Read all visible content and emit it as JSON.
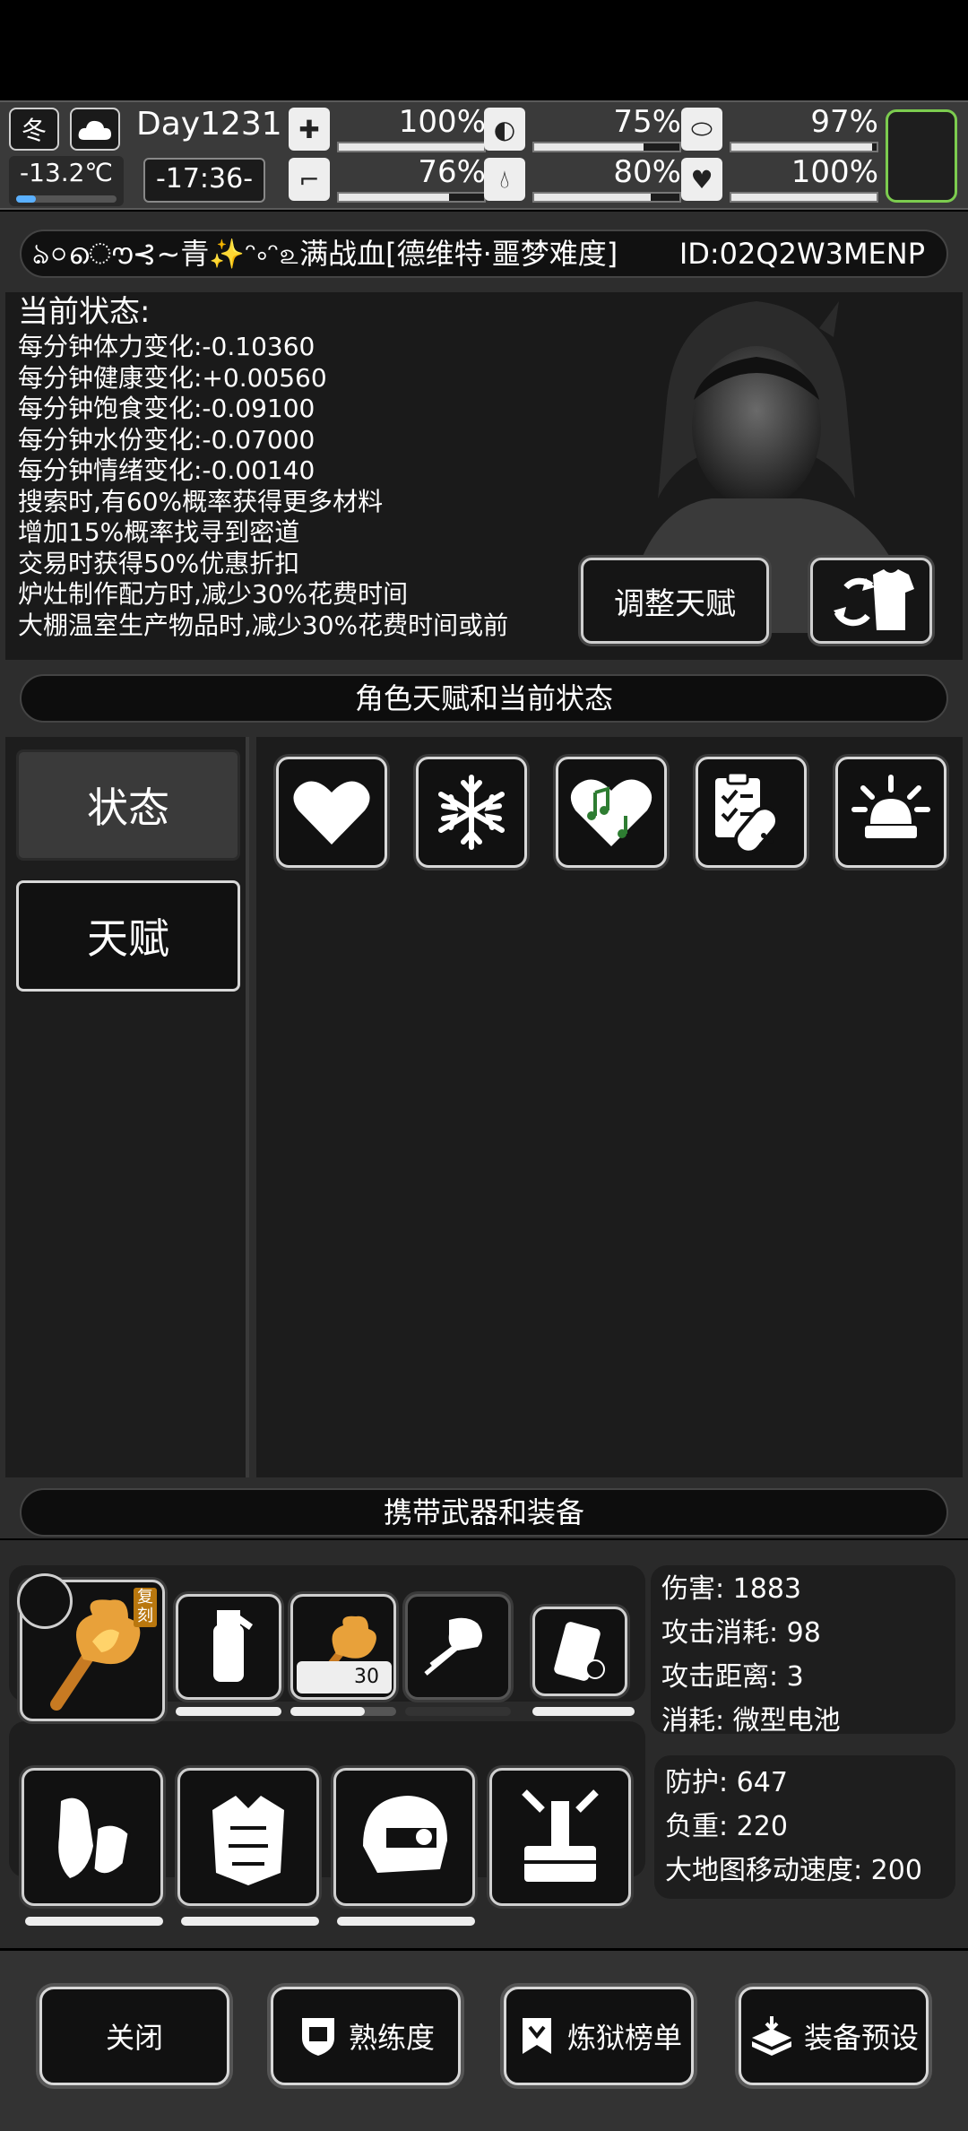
{
  "hud": {
    "season": "冬",
    "temperature": "-13.2℃",
    "temperature_fraction": 0.2,
    "day": "Day1231",
    "time": "-17:36-",
    "stats": [
      {
        "name": "health",
        "icon": "medkit-icon",
        "value": "100%",
        "fraction": 1.0
      },
      {
        "name": "satiety",
        "icon": "stomach-icon",
        "value": "75%",
        "fraction": 0.75
      },
      {
        "name": "stamina",
        "icon": "capsule-icon",
        "value": "97%",
        "fraction": 0.97
      },
      {
        "name": "walk",
        "icon": "boot-icon",
        "value": "76%",
        "fraction": 0.76
      },
      {
        "name": "water",
        "icon": "water-drop-icon",
        "value": "80%",
        "fraction": 0.8
      },
      {
        "name": "mood",
        "icon": "heart-icon",
        "value": "100%",
        "fraction": 1.0
      }
    ]
  },
  "player": {
    "name": "ঌ০ൌ⊰~青✨ᵔ༚ᵔ௨满战血[德维特·噩梦难度]",
    "id": "ID:02Q2W3MENP"
  },
  "status": {
    "header": "当前状态:",
    "lines": [
      "每分钟体力变化:-0.10360",
      "每分钟健康变化:+0.00560",
      "每分钟饱食变化:-0.09100",
      "每分钟水份变化:-0.07000",
      "每分钟情绪变化:-0.00140",
      "搜索时,有60%概率获得更多材料",
      "增加15%概率找寻到密道",
      "交易时获得50%优惠折扣",
      "炉灶制作配方时,减少30%花费时间",
      "大棚温室生产物品时,减少30%花费时间或前"
    ],
    "adjust_button": "调整天赋"
  },
  "talent_section": {
    "title": "角色天赋和当前状态",
    "tabs": [
      "状态",
      "天赋"
    ],
    "icons": [
      "heart-icon",
      "snowflake-icon",
      "music-heart-icon",
      "medicine-icon",
      "alarm-light-icon"
    ]
  },
  "equipment": {
    "title": "携带武器和装备",
    "weapon_tag": "复刻",
    "ammo_count": "30",
    "weapon_stats": [
      "伤害: 1883",
      "攻击消耗: 98",
      "攻击距离: 3",
      "消耗: 微型电池"
    ],
    "armor_stats": [
      "防护: 647",
      "负重: 220",
      "大地图移动速度: 200"
    ]
  },
  "buttons": {
    "close": "关闭",
    "proficiency": "熟练度",
    "ranking": "炼狱榜单",
    "preset": "装备预设"
  }
}
